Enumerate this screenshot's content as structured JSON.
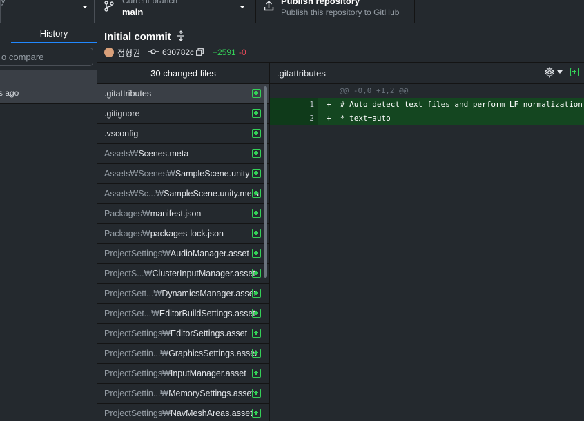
{
  "toolbar": {
    "repo_label": "ory",
    "branch_label": "Current branch",
    "branch_value": "main",
    "publish_label": "Publish repository",
    "publish_sub": "Publish this repository to GitHub"
  },
  "sidebar": {
    "history_tab": "History",
    "compare_placeholder": "o compare",
    "commit_time": "s ago"
  },
  "commit": {
    "title": "Initial commit",
    "author": "정형권",
    "sha": "630782c",
    "additions": "+2591",
    "deletions": "-0"
  },
  "files": {
    "header": "30 changed files",
    "rows": [
      {
        "dir": "",
        "name": ".gitattributes"
      },
      {
        "dir": "",
        "name": ".gitignore"
      },
      {
        "dir": "",
        "name": ".vsconfig"
      },
      {
        "dir": "Assets₩",
        "name": "Scenes.meta"
      },
      {
        "dir": "Assets₩Scenes₩",
        "name": "SampleScene.unity"
      },
      {
        "dir": "Assets₩Sc...₩",
        "name": "SampleScene.unity.meta"
      },
      {
        "dir": "Packages₩",
        "name": "manifest.json"
      },
      {
        "dir": "Packages₩",
        "name": "packages-lock.json"
      },
      {
        "dir": "ProjectSettings₩",
        "name": "AudioManager.asset"
      },
      {
        "dir": "ProjectS...₩",
        "name": "ClusterInputManager.asset"
      },
      {
        "dir": "ProjectSett...₩",
        "name": "DynamicsManager.asset"
      },
      {
        "dir": "ProjectSet...₩",
        "name": "EditorBuildSettings.asset"
      },
      {
        "dir": "ProjectSettings₩",
        "name": "EditorSettings.asset"
      },
      {
        "dir": "ProjectSettin...₩",
        "name": "GraphicsSettings.asset"
      },
      {
        "dir": "ProjectSettings₩",
        "name": "InputManager.asset"
      },
      {
        "dir": "ProjectSettin...₩",
        "name": "MemorySettings.asset"
      },
      {
        "dir": "ProjectSettings₩",
        "name": "NavMeshAreas.asset"
      }
    ]
  },
  "diff": {
    "filename": ".gitattributes",
    "hunk": "@@ -0,0 +1,2 @@",
    "lines": [
      {
        "num": "1",
        "text": "+  # Auto detect text files and perform LF normalization"
      },
      {
        "num": "2",
        "text": "+  * text=auto"
      }
    ]
  }
}
